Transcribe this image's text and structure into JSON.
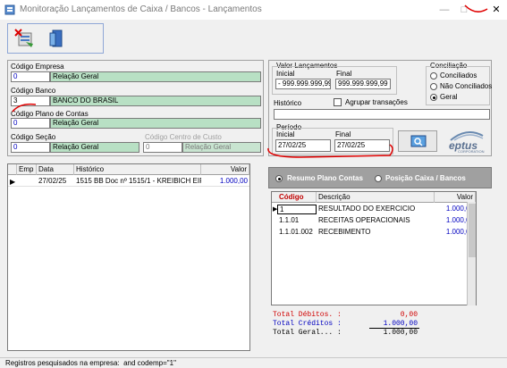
{
  "window": {
    "title": "Monitoração Lançamentos de Caixa / Bancos - Lançamentos"
  },
  "filters": {
    "empresa_label": "Código Empresa",
    "empresa_code": "0",
    "empresa_desc": "Relação Geral",
    "banco_label": "Código Banco",
    "banco_code": "3",
    "banco_desc": "BANCO DO BRASIL",
    "plano_label": "Código Plano de Contas",
    "plano_code": "0",
    "plano_desc": "Relação Geral",
    "secao_label": "Código Seção",
    "secao_code": "0",
    "secao_desc": "Relação Geral",
    "centro_label": "Código Centro de Custo",
    "centro_code": "0",
    "centro_desc": "Relação Geral"
  },
  "valores": {
    "group_label": "Valor Lançamentos",
    "inicial_label": "Inicial",
    "inicial_value": "- 999.999.999,99",
    "final_label": "Final",
    "final_value": "999.999.999,99"
  },
  "conciliacao": {
    "group_label": "Conciliação",
    "options": [
      "Conciliados",
      "Não Conciliados",
      "Geral"
    ],
    "selected": "Geral"
  },
  "historico": {
    "label": "Histórico",
    "value": "",
    "agrupar_label": "Agrupar transações",
    "agrupar_checked": false
  },
  "periodo": {
    "group_label": "Período",
    "inicial_label": "Inicial",
    "inicial_value": "27/02/25",
    "final_label": "Final",
    "final_value": "27/02/25"
  },
  "logo": {
    "text": "eptus",
    "subtext": "CORPORATION"
  },
  "lancamentos": {
    "columns": [
      "Emp",
      "Data",
      "Histórico",
      "Valor"
    ],
    "rows": [
      {
        "emp": "",
        "data": "27/02/25",
        "historico": "1515 BB Doc nº 1515/1 - KREIBICH EIF",
        "valor": "1.000,00"
      }
    ]
  },
  "tabs": {
    "resumo": "Resumo Plano Contas",
    "posicao": "Posição Caixa / Bancos"
  },
  "resumo": {
    "columns": [
      "Código",
      "Descrição",
      "Valor"
    ],
    "rows": [
      {
        "codigo": "1",
        "descricao": "RESULTADO DO EXERCICIO",
        "valor": "1.000,00"
      },
      {
        "codigo": "1.1.01",
        "descricao": "RECEITAS OPERACIONAIS",
        "valor": "1.000,00"
      },
      {
        "codigo": "1.1.01.002",
        "descricao": "RECEBIMENTO",
        "valor": "1.000,00"
      }
    ]
  },
  "totais": {
    "debitos_label": "Total Débitos. :",
    "debitos_value": "0,00",
    "creditos_label": "Total Créditos :",
    "creditos_value": "1.000,00",
    "geral_label": "Total Geral... :",
    "geral_value": "1.000,00"
  },
  "status": {
    "text": "Registros pesquisados na empresa:  and codemp=\"1\""
  },
  "colors": {
    "field_green": "#b8e0c4",
    "value_blue": "#0000c0",
    "red_total": "#d00000",
    "annotation_red": "#e00000"
  }
}
